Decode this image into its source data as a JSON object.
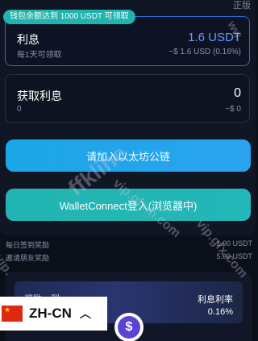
{
  "header": {
    "corner_text": "正版"
  },
  "interest_card": {
    "badge": "钱包余额达到 1000 USDT 可领取",
    "title": "利息",
    "subtitle": "每1天可领取",
    "value": "1.6 USDT",
    "subvalue": "~$ 1.6 USD (0.16%)"
  },
  "earn_card": {
    "title": "获取利息",
    "subtitle": "0",
    "value": "0",
    "subvalue": "~$ 0"
  },
  "buttons": {
    "join_eth": "请加入以太坊公链",
    "wallet_connect": "WalletConnect登入(浏览器中)"
  },
  "info_rows": [
    {
      "label": "每日签到奖励",
      "value": "1.00 USDT"
    },
    {
      "label": "邀请朋友奖励",
      "value": "5.00 USDT"
    }
  ],
  "rate_card": {
    "left_text": "奖励…到",
    "label": "利息利率",
    "value": "0.16%"
  },
  "language": {
    "code": "ZH-CN"
  },
  "watermarks": {
    "main": "ffkline",
    "url1": "vip.gfxm.com",
    "url2": "vip.gfx.com",
    "url3": "vip.",
    "url4": "ww."
  },
  "colors": {
    "accent_blue": "#2aa3ef",
    "accent_teal": "#22b4b0",
    "value_blue": "#6f95ff"
  }
}
